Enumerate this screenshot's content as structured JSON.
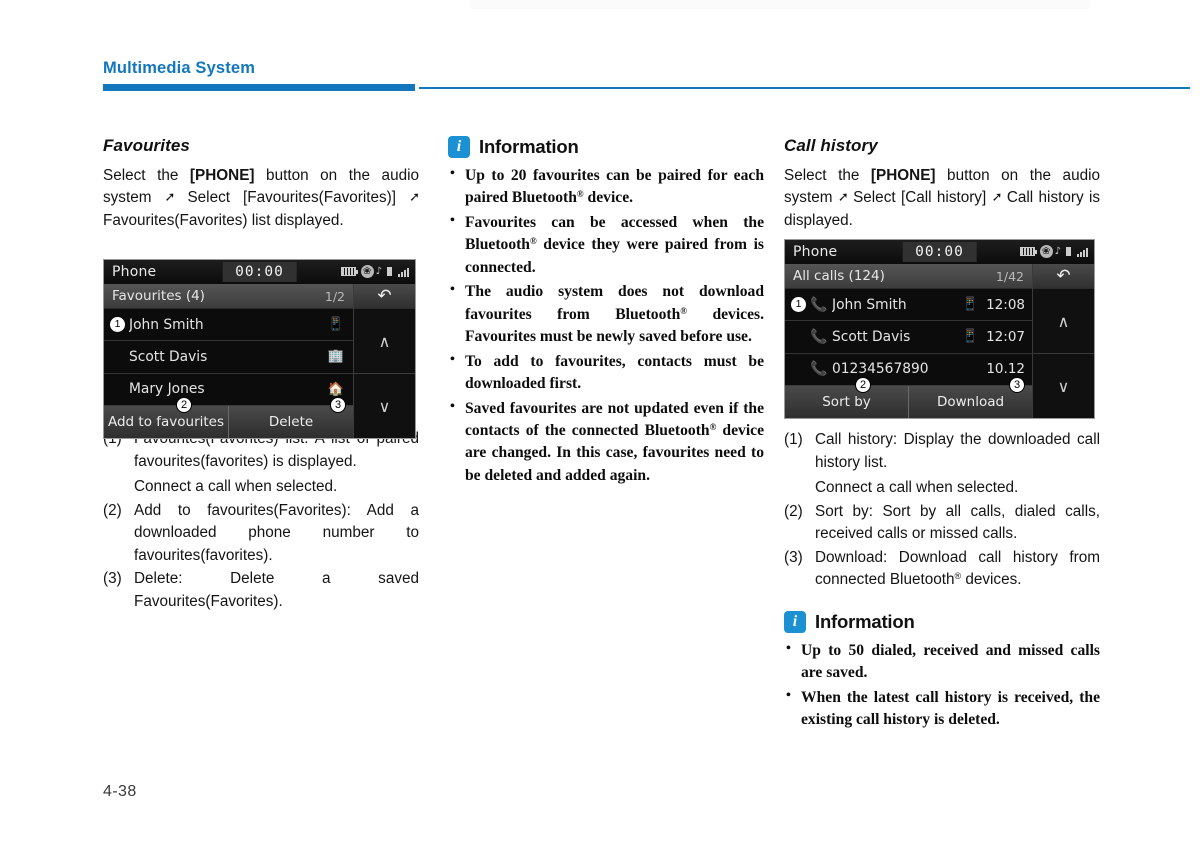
{
  "header": {
    "title": "Multimedia System"
  },
  "page_number": "4-38",
  "col1": {
    "section_title": "Favourites",
    "intro_a": "Select the ",
    "intro_b": "[PHONE]",
    "intro_c": " button on the audio system ",
    "intro_d": " Select [Favourites(Favorites)] ",
    "intro_e": " Favourites(Favorites) list displayed.",
    "items": [
      {
        "marker": "(1)",
        "text": "Favourites(Favorites) list: A list of paired favourites(favorites) is displayed.",
        "sub": "Connect a call when selected."
      },
      {
        "marker": "(2)",
        "text": "Add to favourites(Favorites): Add a downloaded phone number to favourites(favorites)."
      },
      {
        "marker": "(3)",
        "text": "Delete: Delete a saved Favourites(Favorites)."
      }
    ]
  },
  "col2": {
    "info_icon_letter": "i",
    "info_title": "Information",
    "bullets": [
      {
        "parts": [
          "Up to 20 favourites can be paired for each paired Bluetooth",
          "®",
          " device."
        ]
      },
      {
        "parts": [
          "Favourites can be accessed when the Bluetooth",
          "®",
          " device they were paired from is connected."
        ]
      },
      {
        "parts": [
          "The audio system does not download favourites from Bluetooth",
          "®",
          " devices. Favourites must be newly saved before use."
        ]
      },
      {
        "parts": [
          "To add to favourites, contacts must be downloaded first.",
          "",
          ""
        ]
      },
      {
        "parts": [
          "Saved favourites are not updated even if the contacts of the connected Bluetooth",
          "®",
          " device are changed. In this case, favourites need to be deleted and added again."
        ]
      }
    ]
  },
  "col3": {
    "section_title": "Call history",
    "intro_a": "Select the ",
    "intro_b": "[PHONE]",
    "intro_c": " button on the audio system ",
    "intro_d": " Select [Call history] ",
    "intro_e": " Call history is displayed.",
    "items": [
      {
        "marker": "(1)",
        "text": "Call history: Display the downloaded call history list.",
        "sub": "Connect a call when selected."
      },
      {
        "marker": "(2)",
        "text": "Sort by: Sort by all calls, dialed calls, received calls or missed calls."
      },
      {
        "marker": "(3)",
        "text_a": "Download: Download call history from connected Bluetooth",
        "reg": "®",
        "text_b": " devices."
      }
    ],
    "info_icon_letter": "i",
    "info_title": "Information",
    "bullets": [
      "Up to 50 dialed, received and missed calls are saved.",
      "When the latest call history is received, the existing call history is deleted."
    ]
  },
  "screens": {
    "favourites": {
      "status_title": "Phone",
      "clock": "00:00",
      "list_header": "Favourites (4)",
      "page_indicator": "1/2",
      "rows": [
        {
          "callout": "1",
          "name": "John Smith",
          "device_icon": "mobile-phone-icon"
        },
        {
          "callout": "",
          "name": "Scott Davis",
          "device_icon": "office-building-icon"
        },
        {
          "callout": "",
          "name": "Mary Jones",
          "device_icon": "home-icon"
        }
      ],
      "buttons": [
        {
          "label": "Add to favourites",
          "callout": "2"
        },
        {
          "label": "Delete",
          "callout": "3"
        }
      ],
      "rail": {
        "back": "back-arrow-icon",
        "up": "scroll-up-icon",
        "down": "scroll-down-icon"
      }
    },
    "call_history": {
      "status_title": "Phone",
      "clock": "00:00",
      "list_header": "All calls (124)",
      "page_indicator": "1/42",
      "rows": [
        {
          "callout": "1",
          "call_type": "outgoing",
          "name": "John Smith",
          "device_icon": "mobile-phone-icon",
          "time": "12:08"
        },
        {
          "callout": "",
          "call_type": "outgoing",
          "name": "Scott Davis",
          "device_icon": "mobile-phone-icon",
          "time": "12:07"
        },
        {
          "callout": "",
          "call_type": "unknown",
          "name": "01234567890",
          "device_icon": "",
          "time": "10.12"
        }
      ],
      "buttons": [
        {
          "label": "Sort by",
          "callout": "2"
        },
        {
          "label": "Download",
          "callout": "3"
        }
      ],
      "rail": {
        "back": "back-arrow-icon",
        "up": "scroll-up-icon",
        "down": "scroll-down-icon"
      }
    }
  },
  "colors": {
    "accent": "#1277bc",
    "info_badge": "#1b91d3"
  }
}
